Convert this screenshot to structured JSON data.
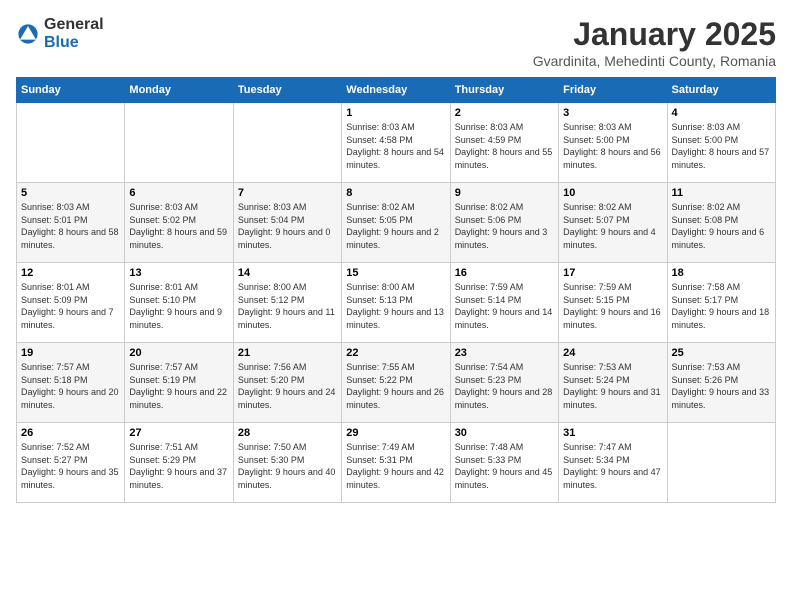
{
  "header": {
    "logo_general": "General",
    "logo_blue": "Blue",
    "title": "January 2025",
    "subtitle": "Gvardinita, Mehedinti County, Romania"
  },
  "weekdays": [
    "Sunday",
    "Monday",
    "Tuesday",
    "Wednesday",
    "Thursday",
    "Friday",
    "Saturday"
  ],
  "weeks": [
    [
      {
        "day": "",
        "info": ""
      },
      {
        "day": "",
        "info": ""
      },
      {
        "day": "",
        "info": ""
      },
      {
        "day": "1",
        "info": "Sunrise: 8:03 AM\nSunset: 4:58 PM\nDaylight: 8 hours\nand 54 minutes."
      },
      {
        "day": "2",
        "info": "Sunrise: 8:03 AM\nSunset: 4:59 PM\nDaylight: 8 hours\nand 55 minutes."
      },
      {
        "day": "3",
        "info": "Sunrise: 8:03 AM\nSunset: 5:00 PM\nDaylight: 8 hours\nand 56 minutes."
      },
      {
        "day": "4",
        "info": "Sunrise: 8:03 AM\nSunset: 5:00 PM\nDaylight: 8 hours\nand 57 minutes."
      }
    ],
    [
      {
        "day": "5",
        "info": "Sunrise: 8:03 AM\nSunset: 5:01 PM\nDaylight: 8 hours\nand 58 minutes."
      },
      {
        "day": "6",
        "info": "Sunrise: 8:03 AM\nSunset: 5:02 PM\nDaylight: 8 hours\nand 59 minutes."
      },
      {
        "day": "7",
        "info": "Sunrise: 8:03 AM\nSunset: 5:04 PM\nDaylight: 9 hours\nand 0 minutes."
      },
      {
        "day": "8",
        "info": "Sunrise: 8:02 AM\nSunset: 5:05 PM\nDaylight: 9 hours\nand 2 minutes."
      },
      {
        "day": "9",
        "info": "Sunrise: 8:02 AM\nSunset: 5:06 PM\nDaylight: 9 hours\nand 3 minutes."
      },
      {
        "day": "10",
        "info": "Sunrise: 8:02 AM\nSunset: 5:07 PM\nDaylight: 9 hours\nand 4 minutes."
      },
      {
        "day": "11",
        "info": "Sunrise: 8:02 AM\nSunset: 5:08 PM\nDaylight: 9 hours\nand 6 minutes."
      }
    ],
    [
      {
        "day": "12",
        "info": "Sunrise: 8:01 AM\nSunset: 5:09 PM\nDaylight: 9 hours\nand 7 minutes."
      },
      {
        "day": "13",
        "info": "Sunrise: 8:01 AM\nSunset: 5:10 PM\nDaylight: 9 hours\nand 9 minutes."
      },
      {
        "day": "14",
        "info": "Sunrise: 8:00 AM\nSunset: 5:12 PM\nDaylight: 9 hours\nand 11 minutes."
      },
      {
        "day": "15",
        "info": "Sunrise: 8:00 AM\nSunset: 5:13 PM\nDaylight: 9 hours\nand 13 minutes."
      },
      {
        "day": "16",
        "info": "Sunrise: 7:59 AM\nSunset: 5:14 PM\nDaylight: 9 hours\nand 14 minutes."
      },
      {
        "day": "17",
        "info": "Sunrise: 7:59 AM\nSunset: 5:15 PM\nDaylight: 9 hours\nand 16 minutes."
      },
      {
        "day": "18",
        "info": "Sunrise: 7:58 AM\nSunset: 5:17 PM\nDaylight: 9 hours\nand 18 minutes."
      }
    ],
    [
      {
        "day": "19",
        "info": "Sunrise: 7:57 AM\nSunset: 5:18 PM\nDaylight: 9 hours\nand 20 minutes."
      },
      {
        "day": "20",
        "info": "Sunrise: 7:57 AM\nSunset: 5:19 PM\nDaylight: 9 hours\nand 22 minutes."
      },
      {
        "day": "21",
        "info": "Sunrise: 7:56 AM\nSunset: 5:20 PM\nDaylight: 9 hours\nand 24 minutes."
      },
      {
        "day": "22",
        "info": "Sunrise: 7:55 AM\nSunset: 5:22 PM\nDaylight: 9 hours\nand 26 minutes."
      },
      {
        "day": "23",
        "info": "Sunrise: 7:54 AM\nSunset: 5:23 PM\nDaylight: 9 hours\nand 28 minutes."
      },
      {
        "day": "24",
        "info": "Sunrise: 7:53 AM\nSunset: 5:24 PM\nDaylight: 9 hours\nand 31 minutes."
      },
      {
        "day": "25",
        "info": "Sunrise: 7:53 AM\nSunset: 5:26 PM\nDaylight: 9 hours\nand 33 minutes."
      }
    ],
    [
      {
        "day": "26",
        "info": "Sunrise: 7:52 AM\nSunset: 5:27 PM\nDaylight: 9 hours\nand 35 minutes."
      },
      {
        "day": "27",
        "info": "Sunrise: 7:51 AM\nSunset: 5:29 PM\nDaylight: 9 hours\nand 37 minutes."
      },
      {
        "day": "28",
        "info": "Sunrise: 7:50 AM\nSunset: 5:30 PM\nDaylight: 9 hours\nand 40 minutes."
      },
      {
        "day": "29",
        "info": "Sunrise: 7:49 AM\nSunset: 5:31 PM\nDaylight: 9 hours\nand 42 minutes."
      },
      {
        "day": "30",
        "info": "Sunrise: 7:48 AM\nSunset: 5:33 PM\nDaylight: 9 hours\nand 45 minutes."
      },
      {
        "day": "31",
        "info": "Sunrise: 7:47 AM\nSunset: 5:34 PM\nDaylight: 9 hours\nand 47 minutes."
      },
      {
        "day": "",
        "info": ""
      }
    ]
  ]
}
